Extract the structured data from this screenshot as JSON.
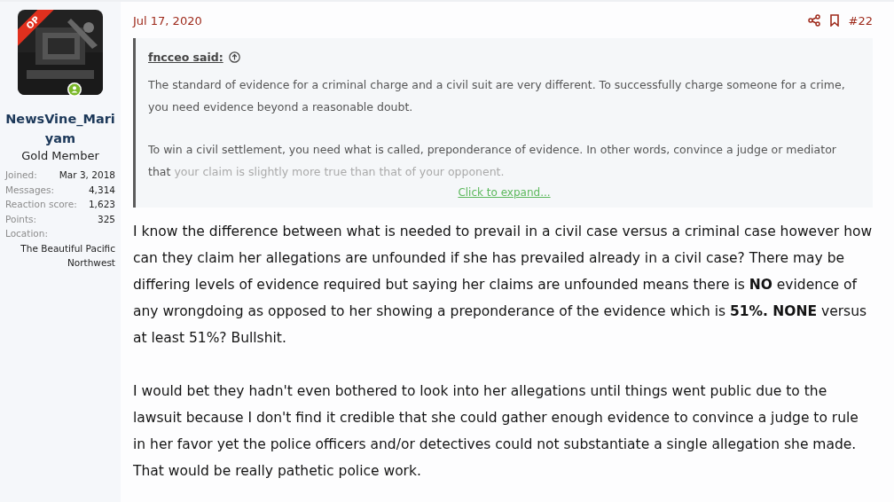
{
  "user": {
    "badge": "OP",
    "name": "NewsVine_Mariyam",
    "title": "Gold Member",
    "stats": [
      {
        "label": "Joined:",
        "value": "Mar 3, 2018"
      },
      {
        "label": "Messages:",
        "value": "4,314"
      },
      {
        "label": "Reaction score:",
        "value": "1,623"
      },
      {
        "label": "Points:",
        "value": "325"
      }
    ],
    "location": {
      "label": "Location:",
      "value": "The Beautiful Pacific Northwest"
    }
  },
  "post": {
    "date": "Jul 17, 2020",
    "number": "#22",
    "quote": {
      "author": "fncceo said:",
      "paragraphs": [
        "The standard of evidence for a criminal charge and a civil suit are very different. To successfully charge someone for a crime, you need evidence beyond a reasonable doubt.",
        "To win a civil settlement, you need what is called, preponderance of evidence. In other words, convince a judge or mediator that your claim is slightly more true than that of your opponent."
      ],
      "expand": "Click to expand..."
    },
    "paragraphs": [
      "I know the difference between what is needed to prevail in a civil case versus a criminal case however how can they claim her allegations are unfounded if she has prevailed already in a civil case? There may be differing levels of evidence required but saying her claims are unfounded means there is **NO** evidence of any wrongdoing as opposed to her showing a preponderance of the evidence which is **51%. NONE** versus at least 51%? Bullshit.",
      "I would bet they hadn't even bothered to look into her allegations until things went public due to the lawsuit because I don't find it credible that she could gather enough evidence to convince a judge to rule in her favor yet the police officers and/or detectives could not substantiate a single allegation she made. That would be really pathetic police work."
    ]
  }
}
